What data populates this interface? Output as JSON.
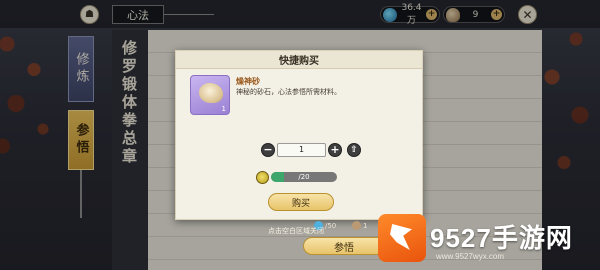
{
  "header": {
    "title": "心法",
    "resources": [
      {
        "name": "spirit-crystal",
        "value": "36.4万"
      },
      {
        "name": "refining-sand",
        "value": "9"
      }
    ]
  },
  "side_tabs": [
    "修炼",
    "参悟"
  ],
  "scroll": {
    "title": "修罗锻体拳总章"
  },
  "dialog": {
    "title": "快捷购买",
    "item": {
      "name": "燥神砂",
      "description": "神秘的砂石，心法参悟所需材料。",
      "count": "1"
    },
    "quantity": "1",
    "price": {
      "text": "/20",
      "fill": 0.2
    },
    "buy_label": "购买"
  },
  "footer": {
    "hint": "点击空白区域关闭",
    "cost_1": "/50",
    "cost_2": "1",
    "canwu_label": "参悟"
  },
  "watermark": {
    "text": "9527手游网",
    "url": "www.9527wyx.com"
  },
  "colors": {
    "accent_gold": "#e8c46a",
    "tab_blue": "#5e6790",
    "progress_green": "#3da66a"
  }
}
